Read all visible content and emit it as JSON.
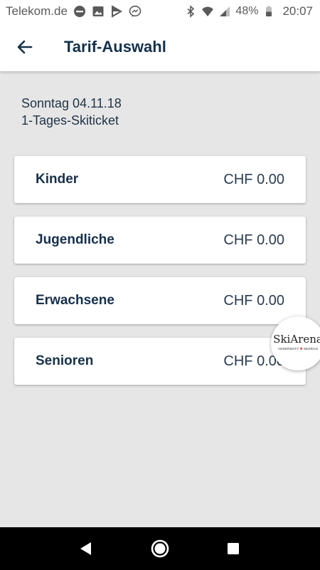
{
  "status_bar": {
    "carrier": "Telekom.de",
    "icons_left": [
      "minus-circle-icon",
      "image-icon",
      "play-store-icon",
      "messenger-icon"
    ],
    "icons_right": [
      "bluetooth-icon",
      "wifi-icon",
      "signal-icon"
    ],
    "battery": "48%",
    "time": "20:07"
  },
  "app_bar": {
    "back_icon": "arrow-left-icon",
    "title": "Tarif-Auswahl"
  },
  "subheader": {
    "date": "Sonntag 04.11.18",
    "ticket": "1-Tages-Skiticket"
  },
  "tariffs": [
    {
      "name": "Kinder",
      "price": "CHF 0.00"
    },
    {
      "name": "Jugendliche",
      "price": "CHF 0.00"
    },
    {
      "name": "Erwachsene",
      "price": "CHF 0.00"
    },
    {
      "name": "Senioren",
      "price": "CHF 0.00"
    }
  ],
  "logo": {
    "main": "SkiArena",
    "sub_left": "ANDERMATT",
    "sub_right": "SEDRUN"
  },
  "nav_bar": {
    "buttons": [
      "back-triangle-icon",
      "home-circle-icon",
      "recents-square-icon"
    ]
  }
}
